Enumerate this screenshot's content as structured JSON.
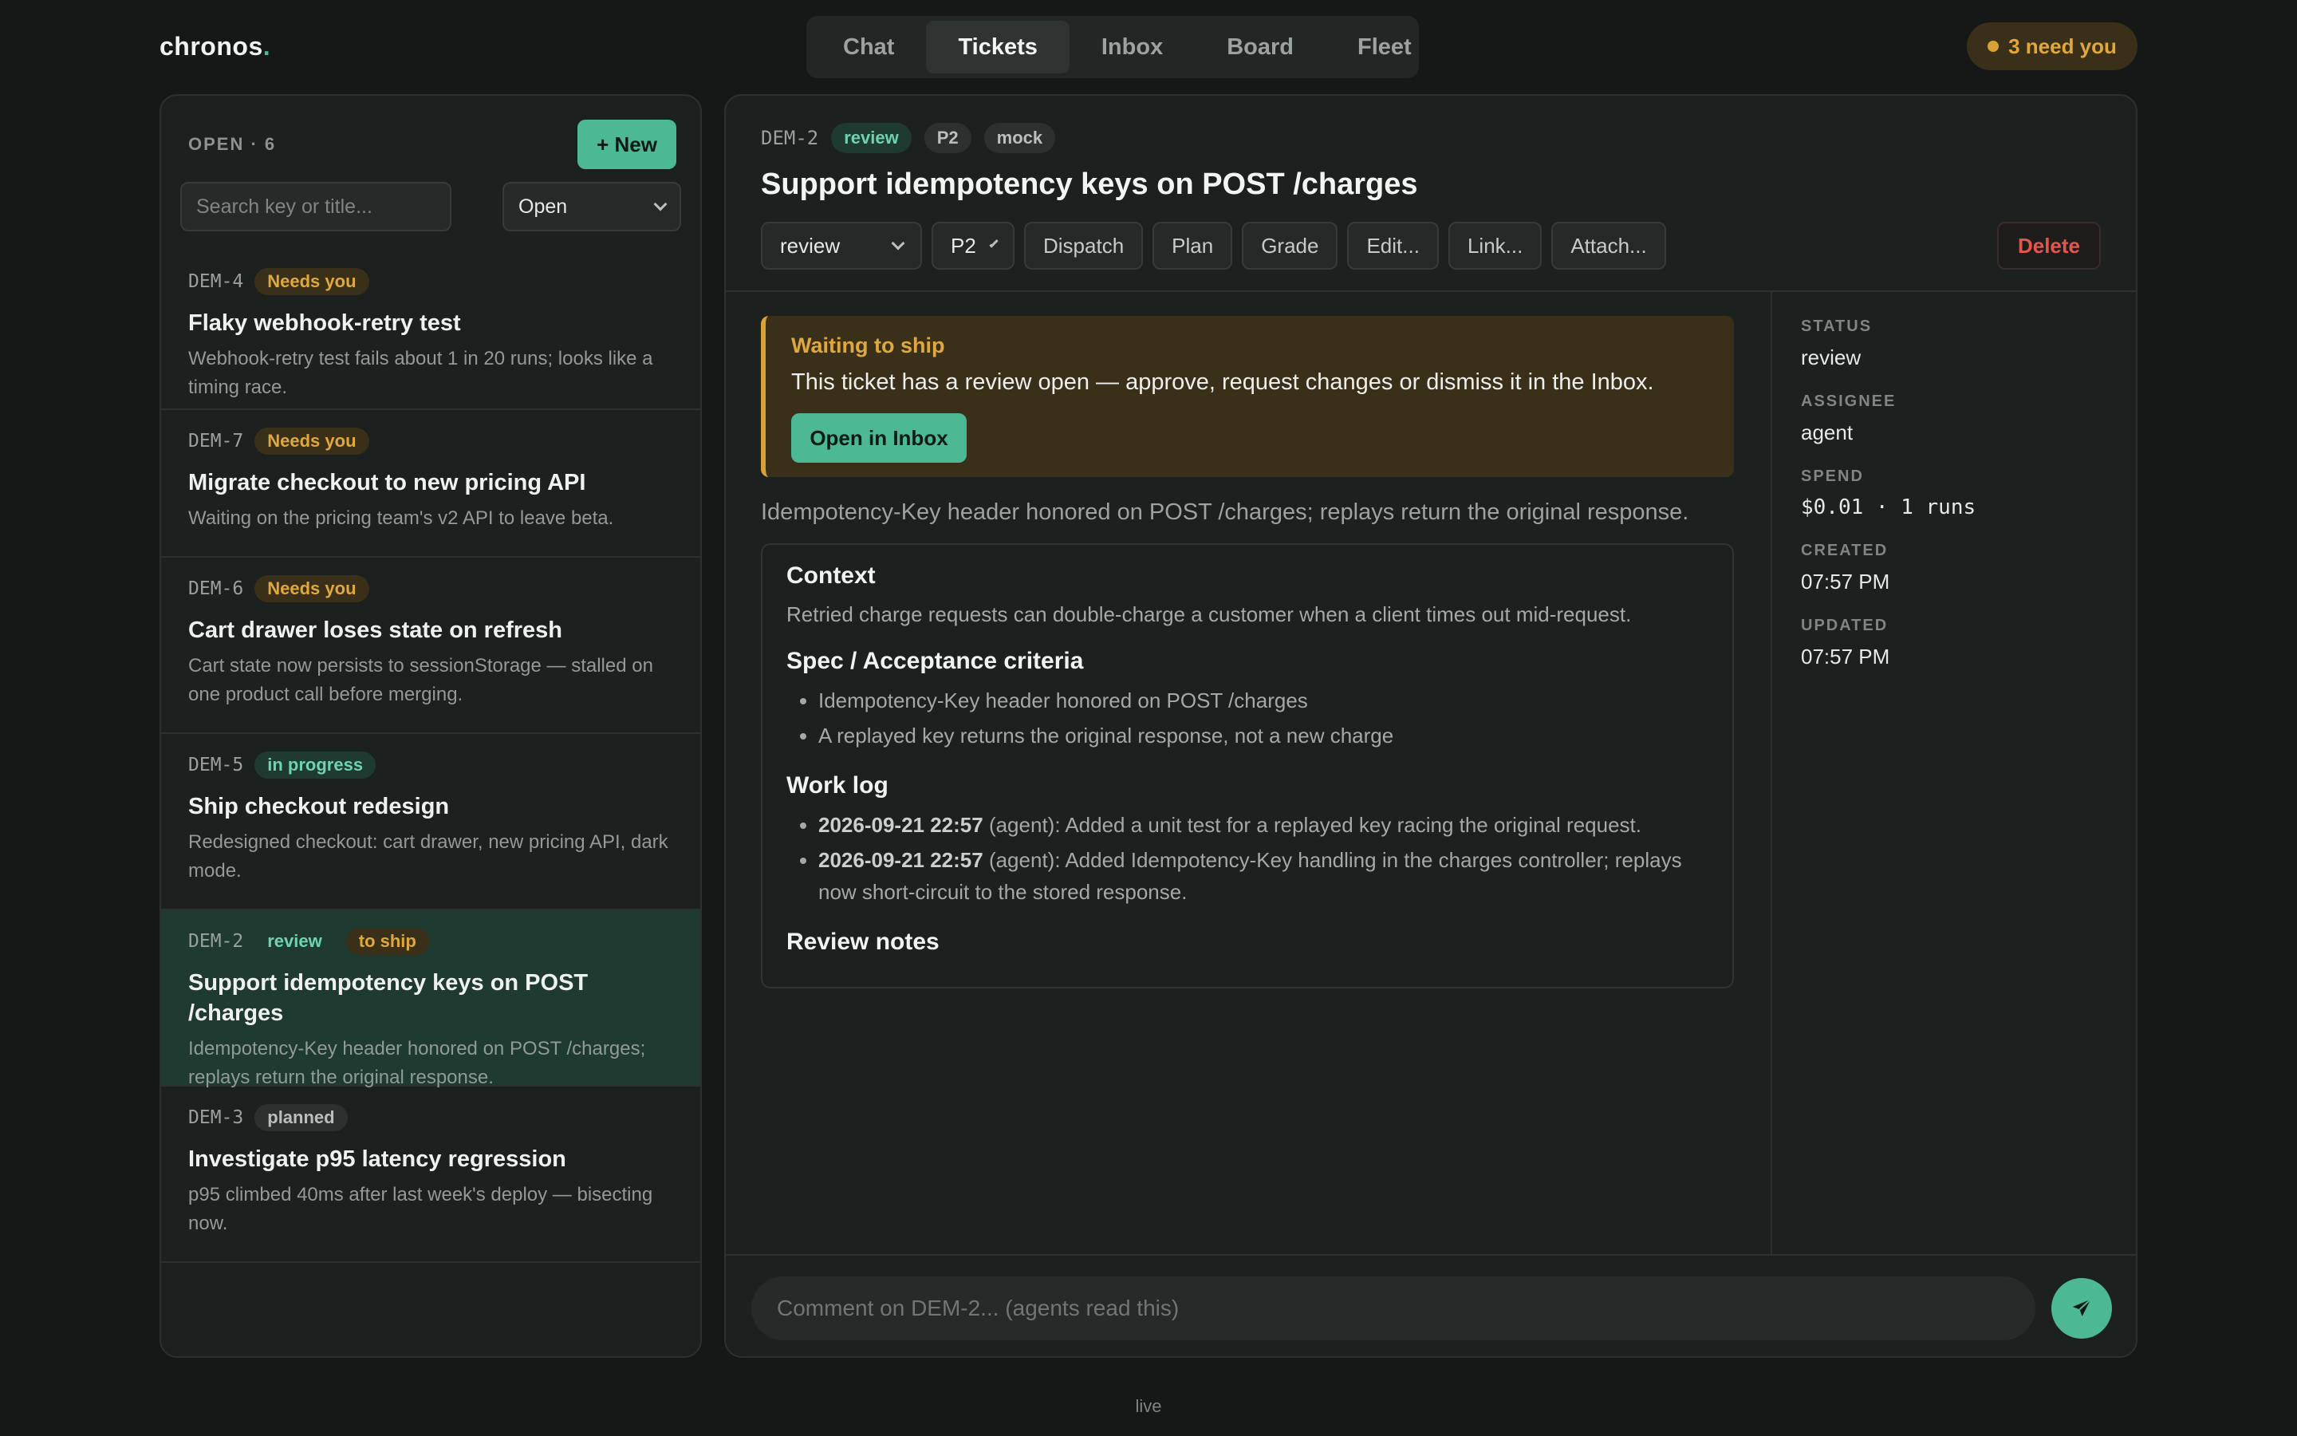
{
  "app": {
    "name": "chronos",
    "dot": "."
  },
  "nav": {
    "tabs": [
      {
        "label": "Chat"
      },
      {
        "label": "Tickets",
        "active": true
      },
      {
        "label": "Inbox"
      },
      {
        "label": "Board"
      },
      {
        "label": "Fleet"
      }
    ]
  },
  "attention": {
    "label": "3 need you",
    "color": "#d8a134"
  },
  "list": {
    "count_label": "OPEN · 6",
    "new_label": "+ New",
    "search_placeholder": "Search key or title...",
    "filter_value": "Open",
    "tickets": [
      {
        "key": "DEM-4",
        "badges": [
          "Needs you"
        ],
        "title": "Flaky webhook-retry test",
        "desc": "Webhook-retry test fails about 1 in 20 runs; looks like a timing race."
      },
      {
        "key": "DEM-7",
        "badges": [
          "Needs you"
        ],
        "title": "Migrate checkout to new pricing API",
        "desc": "Waiting on the pricing team's v2 API to leave beta."
      },
      {
        "key": "DEM-6",
        "badges": [
          "Needs you"
        ],
        "title": "Cart drawer loses state on refresh",
        "desc": "Cart state now persists to sessionStorage — stalled on one product call before merging."
      },
      {
        "key": "DEM-5",
        "badges": [
          "in progress"
        ],
        "title": "Ship checkout redesign",
        "desc": "Redesigned checkout: cart drawer, new pricing API, dark mode."
      },
      {
        "key": "DEM-2",
        "badges": [
          "review",
          "to ship"
        ],
        "title": "Support idempotency keys on POST /charges",
        "desc": "Idempotency-Key header honored on POST /charges; replays return the original response.",
        "selected": true
      },
      {
        "key": "DEM-3",
        "badges": [
          "planned"
        ],
        "title": "Investigate p95 latency regression",
        "desc": "p95 climbed 40ms after last week's deploy — bisecting now."
      }
    ]
  },
  "detail": {
    "key": "DEM-2",
    "chips": [
      "review",
      "P2",
      "mock"
    ],
    "title": "Support idempotency keys on POST /charges",
    "toolbar": {
      "status_value": "review",
      "priority_value": "P2",
      "dispatch": "Dispatch",
      "plan": "Plan",
      "grade": "Grade",
      "edit": "Edit...",
      "link": "Link...",
      "attach": "Attach...",
      "delete": "Delete"
    },
    "alert": {
      "title": "Waiting to ship",
      "body": "This ticket has a review open — approve, request changes or dismiss it in the Inbox.",
      "button": "Open in Inbox"
    },
    "summary": "Idempotency-Key header honored on POST /charges; replays return the original response.",
    "context": {
      "heading": "Context",
      "text": "Retried charge requests can double-charge a customer when a client times out mid-request."
    },
    "spec": {
      "heading": "Spec / Acceptance criteria",
      "items": [
        "Idempotency-Key header honored on POST /charges",
        "A replayed key returns the original response, not a new charge"
      ]
    },
    "worklog": {
      "heading": "Work log",
      "items": [
        {
          "time": "2026-09-21 22:57",
          "text": " (agent): Added a unit test for a replayed key racing the original request."
        },
        {
          "time": "2026-09-21 22:57",
          "text": " (agent): Added Idempotency-Key handling in the charges controller; replays now short-circuit to the stored response."
        }
      ]
    },
    "review_notes": {
      "heading": "Review notes"
    },
    "meta": {
      "status_label": "STATUS",
      "status_value": "review",
      "assignee_label": "ASSIGNEE",
      "assignee_value": "agent",
      "spend_label": "SPEND",
      "spend_value": "$0.01 · 1 runs",
      "created_label": "CREATED",
      "created_value": "07:57 PM",
      "updated_label": "UPDATED",
      "updated_value": "07:57 PM"
    },
    "comment_placeholder": "Comment on DEM-2... (agents read this)"
  },
  "footer": {
    "status": "live"
  },
  "colors": {
    "accent": "#4cb994",
    "warning": "#d8a134",
    "danger": "#e2574c",
    "background": "#151816"
  }
}
